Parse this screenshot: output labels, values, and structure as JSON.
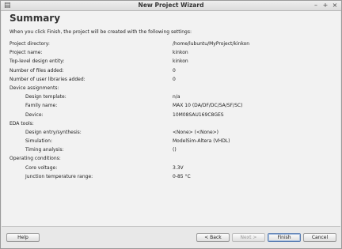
{
  "window": {
    "title": "New Project Wizard"
  },
  "page": {
    "heading": "Summary",
    "intro": "When you click Finish, the project will be created with the following settings:"
  },
  "rows": [
    {
      "label": "Project directory:",
      "value": "/home/lubuntu/MyProject/kinkon"
    },
    {
      "label": "Project name:",
      "value": "kinkon"
    },
    {
      "label": "Top-level design entity:",
      "value": "kinkon"
    },
    {
      "label": "Number of files added:",
      "value": "0"
    },
    {
      "label": "Number of user libraries added:",
      "value": "0"
    },
    {
      "label": "Device assignments:",
      "value": ""
    },
    {
      "label": "Design template:",
      "value": "n/a"
    },
    {
      "label": "Family name:",
      "value": "MAX 10 (DA/DF/DC/SA/SF/SC)"
    },
    {
      "label": "Device:",
      "value": "10M08SAU169C8GES"
    },
    {
      "label": "EDA tools:",
      "value": ""
    },
    {
      "label": "Design entry/synthesis:",
      "value": "<None> (<None>)"
    },
    {
      "label": "Simulation:",
      "value": "ModelSim-Altera (VHDL)"
    },
    {
      "label": "Timing analysis:",
      "value": "()"
    },
    {
      "label": "Operating conditions:",
      "value": ""
    },
    {
      "label": "Core voltage:",
      "value": "3.3V"
    },
    {
      "label": "Junction temperature range:",
      "value": "0-85 °C"
    }
  ],
  "buttons": {
    "help": "Help",
    "back": "< Back",
    "next": "Next >",
    "finish": "Finish",
    "cancel": "Cancel"
  },
  "icons": {
    "app": "wizard-app-icon",
    "minimize": "minimize-icon",
    "maximize": "maximize-icon",
    "close": "close-icon"
  }
}
